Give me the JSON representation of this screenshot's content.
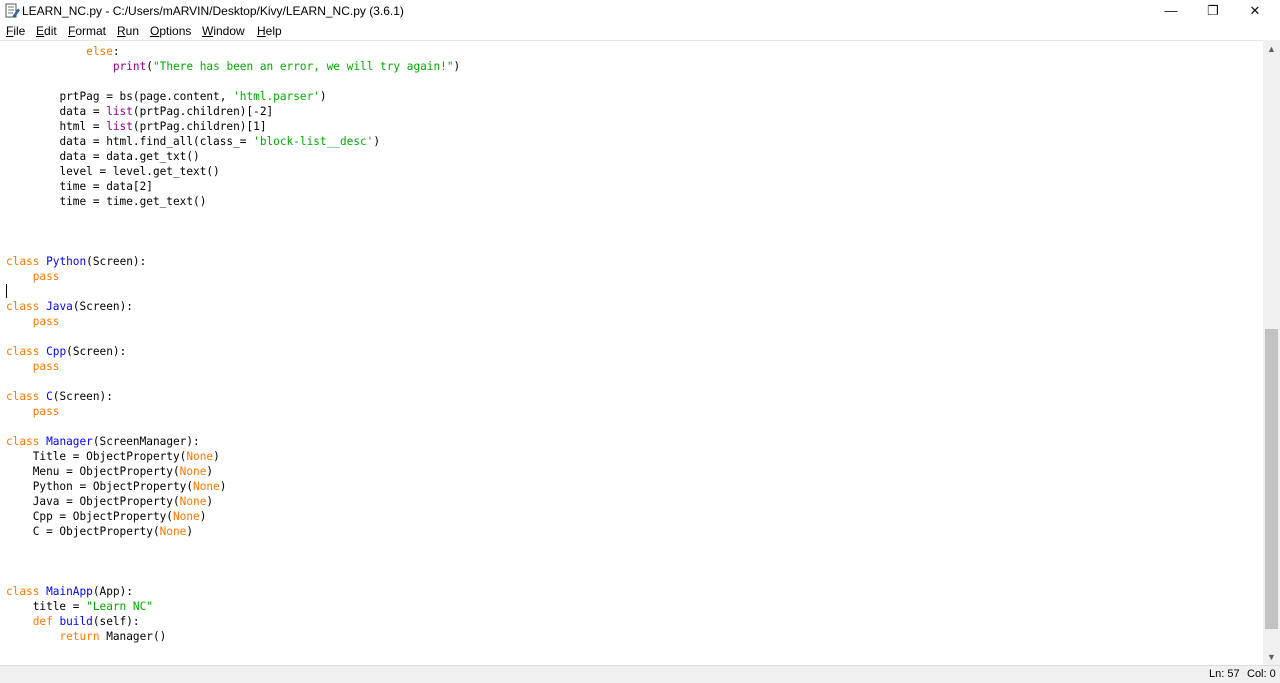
{
  "window": {
    "title": "LEARN_NC.py - C:/Users/mARVIN/Desktop/Kivy/LEARN_NC.py (3.6.1)",
    "minimize_symbol": "—",
    "restore_symbol": "❐",
    "close_symbol": "✕"
  },
  "menu": {
    "file": "File",
    "edit": "Edit",
    "format": "Format",
    "run": "Run",
    "options": "Options",
    "window": "Window",
    "help": "Help"
  },
  "colors": {
    "keyword": "#ff7700",
    "builtin": "#900090",
    "string": "#00aa00",
    "definition": "#0000ff",
    "default": "#000000"
  },
  "code": {
    "l1": [
      "else",
      ":"
    ],
    "l2": [
      "print",
      "(",
      "\"There has been an error, we will try again!\"",
      ")"
    ],
    "l3": [
      "prtPag = bs(page.content, ",
      "'html.parser'",
      ")"
    ],
    "l4": [
      "data = ",
      "list",
      "(prtPag.children)[-2]"
    ],
    "l5": [
      "html = ",
      "list",
      "(prtPag.children)[1]"
    ],
    "l6": [
      "data = html.find_all(class_= ",
      "'block-list__desc'",
      ")"
    ],
    "l7": "data = data.get_txt()",
    "l8": "level = level.get_text()",
    "l9": "time = data[2]",
    "l10": "time = time.get_text()",
    "l11": [
      "class",
      " ",
      "Python",
      "(Screen):"
    ],
    "l12": "pass",
    "l13": [
      "class",
      " ",
      "Java",
      "(Screen):"
    ],
    "l14": "pass",
    "l15": [
      "class",
      " ",
      "Cpp",
      "(Screen):"
    ],
    "l16": "pass",
    "l17": [
      "class",
      " ",
      "C",
      "(Screen):"
    ],
    "l18": "pass",
    "l19": [
      "class",
      " ",
      "Manager",
      "(ScreenManager):"
    ],
    "l20": [
      "Title = ObjectProperty(",
      "None",
      ")"
    ],
    "l21": [
      "Menu = ObjectProperty(",
      "None",
      ")"
    ],
    "l22": [
      "Python = ObjectProperty(",
      "None",
      ")"
    ],
    "l23": [
      "Java = ObjectProperty(",
      "None",
      ")"
    ],
    "l24": [
      "Cpp = ObjectProperty(",
      "None",
      ")"
    ],
    "l25": [
      "C = ObjectProperty(",
      "None",
      ")"
    ],
    "l26": [
      "class",
      " ",
      "MainApp",
      "(App):"
    ],
    "l27": [
      "title = ",
      "\"Learn NC\""
    ],
    "l28": [
      "def",
      " ",
      "build",
      "(self):"
    ],
    "l29": [
      "return",
      " Manager()"
    ]
  },
  "status": {
    "line": "Ln: 57",
    "col": "Col: 0"
  }
}
